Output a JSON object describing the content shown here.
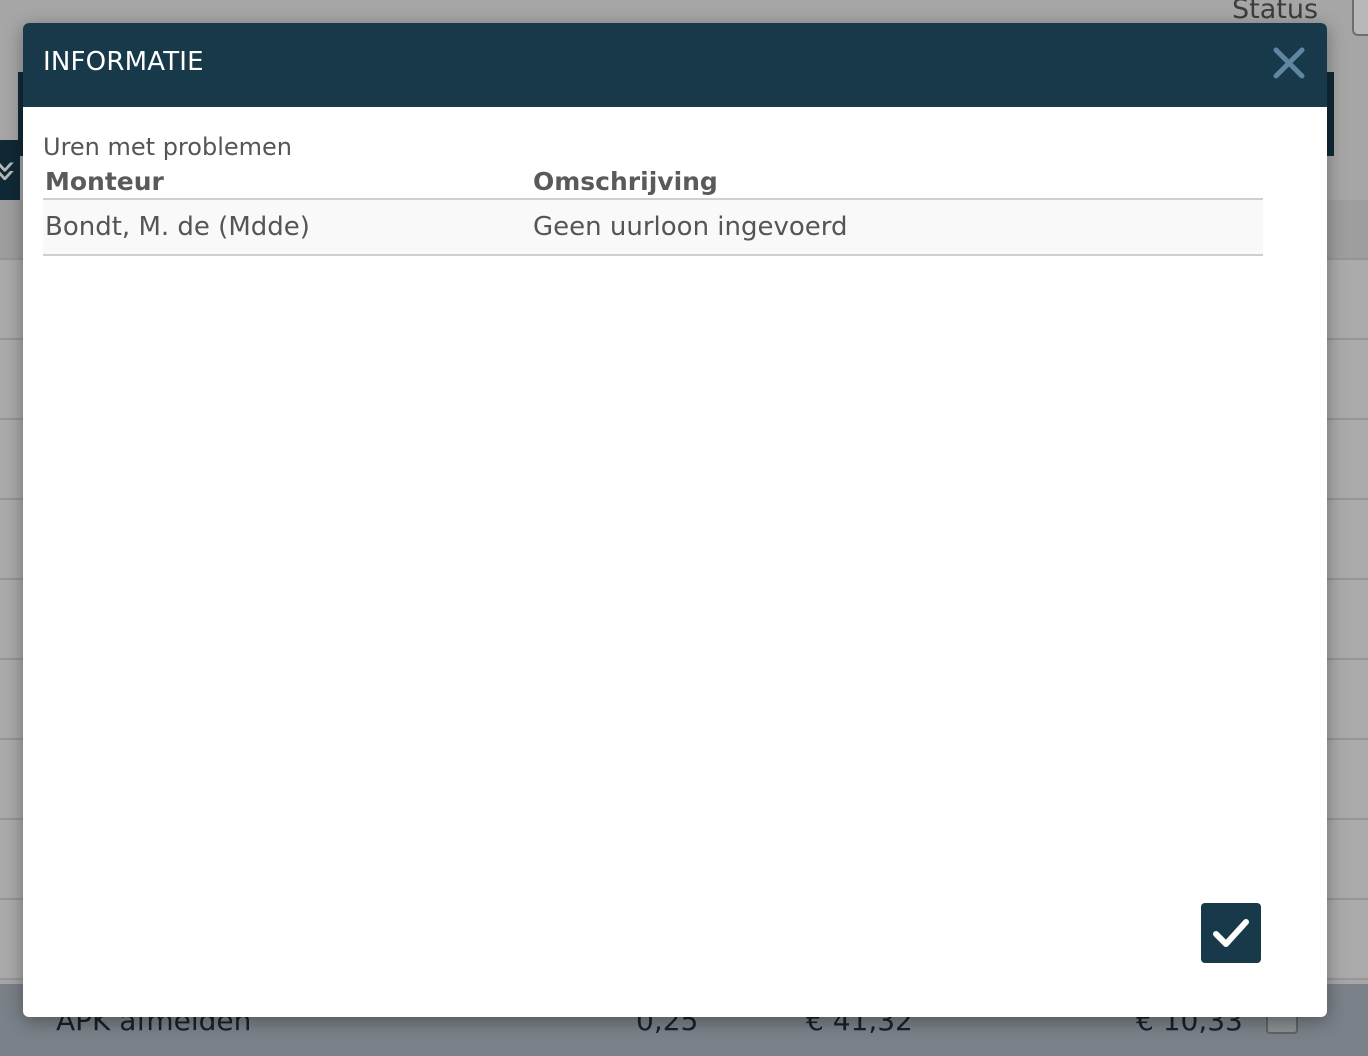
{
  "background": {
    "status_label": "Status",
    "footer_row": {
      "description": "APK afmelden",
      "quantity": "0,25",
      "price": "€ 41,32",
      "total": "€ 10,33"
    }
  },
  "modal": {
    "title": "INFORMATIE",
    "section_title": "Uren met problemen",
    "columns": [
      "Monteur",
      "Omschrijving"
    ],
    "rows": [
      {
        "monteur": "Bondt, M. de (Mdde)",
        "omschrijving": "Geen uurloon ingevoerd"
      }
    ]
  },
  "colors": {
    "header": "#17394a",
    "close_icon": "#5f86a3",
    "confirm_button": "#17394a"
  },
  "icons": {
    "close": "close-icon",
    "confirm": "checkmark-icon"
  }
}
